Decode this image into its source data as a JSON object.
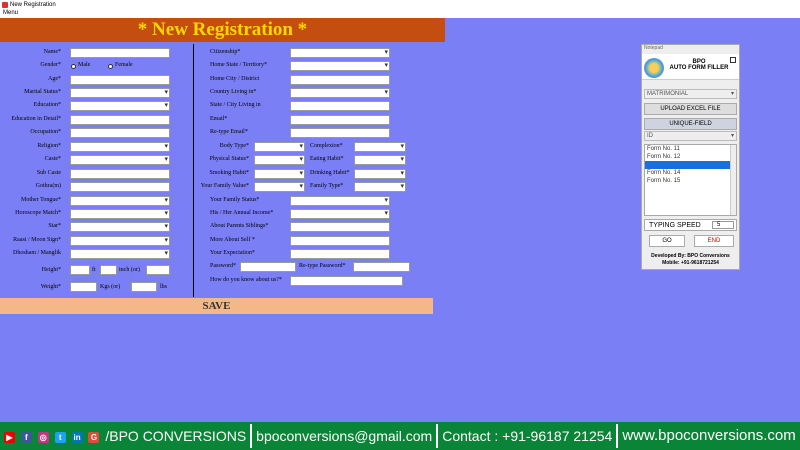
{
  "window": {
    "title": "New Registration",
    "menu": "Menu"
  },
  "banner": "* New Registration *",
  "left": {
    "name": "Name*",
    "gender": "Gender*",
    "male": "Male",
    "female": "Female",
    "age": "Age*",
    "marital": "Marital Status*",
    "education": "Education*",
    "education_detail": "Education in Detail*",
    "occupation": "Occupation*",
    "religion": "Religion*",
    "caste": "Caste*",
    "subcaste": "Sub Caste",
    "gotra": "Gothra(m)",
    "mother_tongue": "Mother Tongue*",
    "horoscope": "Horoscope Match*",
    "star": "Star*",
    "raasi": "Raasi / Moon Sign*",
    "dhosham": "Dhosham / Manglik",
    "height": "Height*",
    "ft": "ft",
    "inch": "inch   (or)",
    "weight": "Weight*",
    "kgs": "Kgs    (or)",
    "lbs": "lbs"
  },
  "right": {
    "citizenship": "Citizenship*",
    "home_state": "Home State / Territory*",
    "home_city": "Home City / District",
    "country_living": "Country Living in*",
    "state_living": "State / City Living in",
    "email": "Email*",
    "retype_email": "Re-type Email*",
    "body_type": "Body Type*",
    "complexion": "Complexion*",
    "physical": "Physical Status*",
    "eating": "Eating Habit*",
    "smoking": "Smoking Habit*",
    "drinking": "Drinking Habit*",
    "family_value": "Your Family Value*",
    "family_type": "Family Type*",
    "family_status": "Your Family Status*",
    "annual_income": "His / Her Annual Income*",
    "about_parents": "About Parents  Siblings*",
    "more_about": "More About Self *",
    "expectation": "Your Expectation*",
    "password": "Password*",
    "retype_password": "Re-type Password*",
    "how_know": "How do you know about us?*"
  },
  "save": "SAVE",
  "panel": {
    "header": "Notepad",
    "brand1": "BPO",
    "brand2": "AUTO FORM FILLER",
    "category": "MATRIMONIAL",
    "upload": "UPLOAD EXCEL FILE",
    "unique": "UNIQUE-FIELD",
    "id": "ID",
    "forms": [
      "Form No. 11",
      "Form No. 12",
      "",
      "Form No. 14",
      "Form No. 15"
    ],
    "typing_speed": "TYPING SPEED",
    "speed_value": "5",
    "go": "GO",
    "end": "END",
    "dev": "Developed By: BPO Conversions",
    "mobile": "Mobile: +91-9618721254"
  },
  "footer": {
    "company": "/BPO CONVERSIONS",
    "email": "bpoconversions@gmail.com",
    "contact": "Contact : +91-96187 21254",
    "website": "www.bpoconversions.com"
  },
  "colors": {
    "background": "#7b7ff5",
    "banner": "#c44e10",
    "banner_text": "#ffd800",
    "save": "#f4b787",
    "footer": "#0a8436",
    "end_text": "#d40000"
  }
}
